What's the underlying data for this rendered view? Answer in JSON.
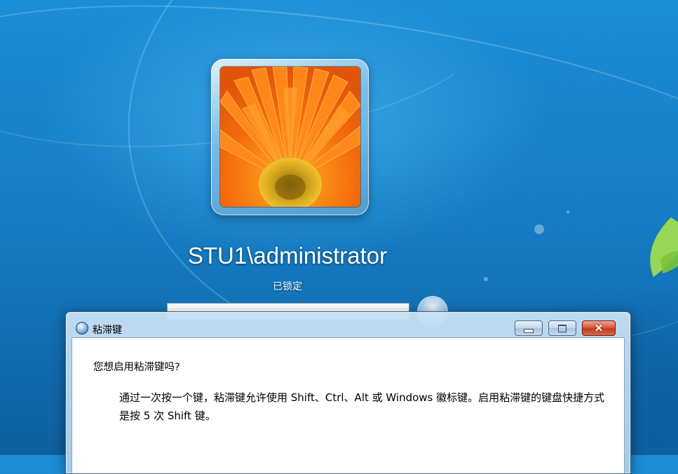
{
  "lock_screen": {
    "username": "STU1\\administrator",
    "status": "已锁定"
  },
  "dialog": {
    "title": "粘滞键",
    "question": "您想启用粘滞键吗?",
    "description": "通过一次按一个键，粘滞键允许使用 Shift、Ctrl、Alt 或 Windows 徽标键。启用粘滞键的键盘快捷方式是按 5 次 Shift 键。",
    "buttons": {
      "minimize": "minimize-icon",
      "maximize": "maximize-icon",
      "close": "close-icon"
    }
  },
  "colors": {
    "desktop_blue": "#1479c0",
    "close_red": "#c23a1d"
  }
}
